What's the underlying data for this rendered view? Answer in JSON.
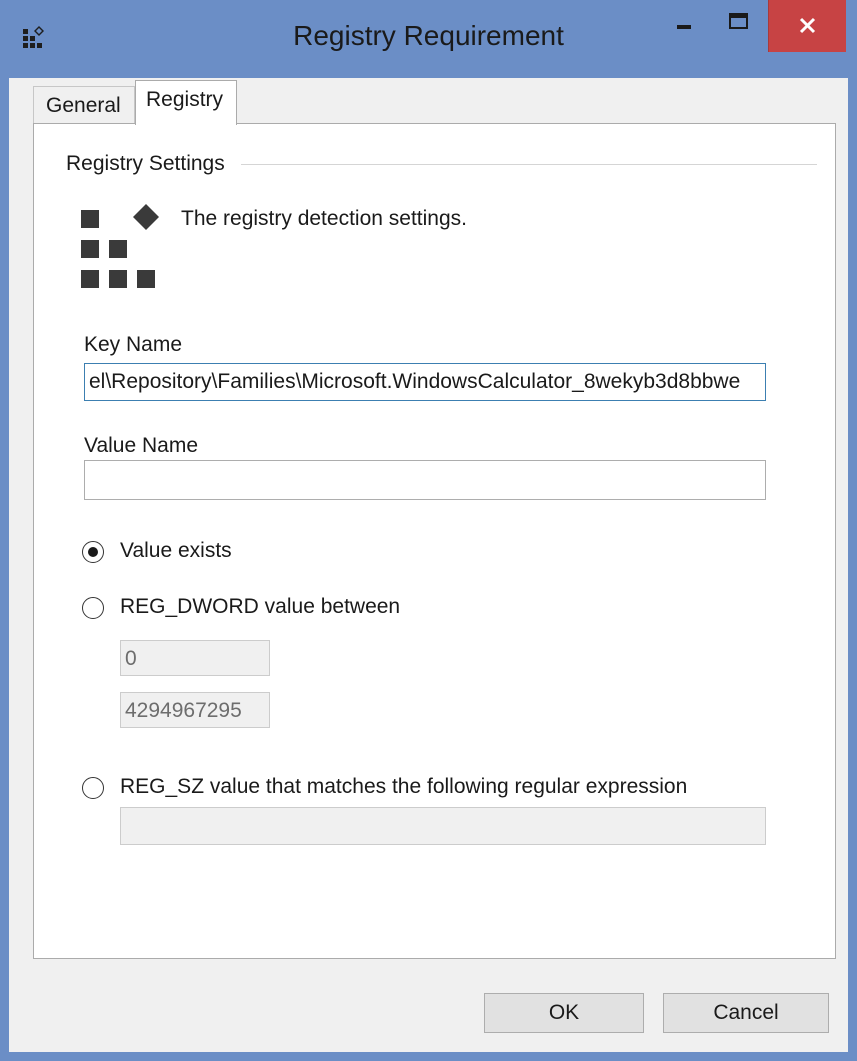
{
  "window": {
    "title": "Registry Requirement",
    "icon": "registry-app-icon",
    "controls": [
      "minimize-icon",
      "maximize-icon",
      "close-icon"
    ],
    "close_color": "#c74344",
    "titlebar_color": "#6b8ec6"
  },
  "tabs": [
    {
      "label": "General",
      "selected": false
    },
    {
      "label": "Registry",
      "selected": true
    }
  ],
  "registry_tab": {
    "group_label": "Registry Settings",
    "icon": "registry-icon",
    "description": "The registry detection settings.",
    "key_name": {
      "label": "Key Name",
      "value": "el\\Repository\\Families\\Microsoft.WindowsCalculator_8wekyb3d8bbwe"
    },
    "value_name": {
      "label": "Value Name",
      "value": ""
    },
    "options": [
      {
        "label": "Value exists",
        "checked": true
      },
      {
        "label": "REG_DWORD value between",
        "checked": false
      },
      {
        "label": "REG_SZ value that matches the following regular expression",
        "checked": false
      }
    ],
    "dword_min": "0",
    "dword_max": "4294967295",
    "regex_value": ""
  },
  "buttons": {
    "ok": "OK",
    "cancel": "Cancel"
  }
}
